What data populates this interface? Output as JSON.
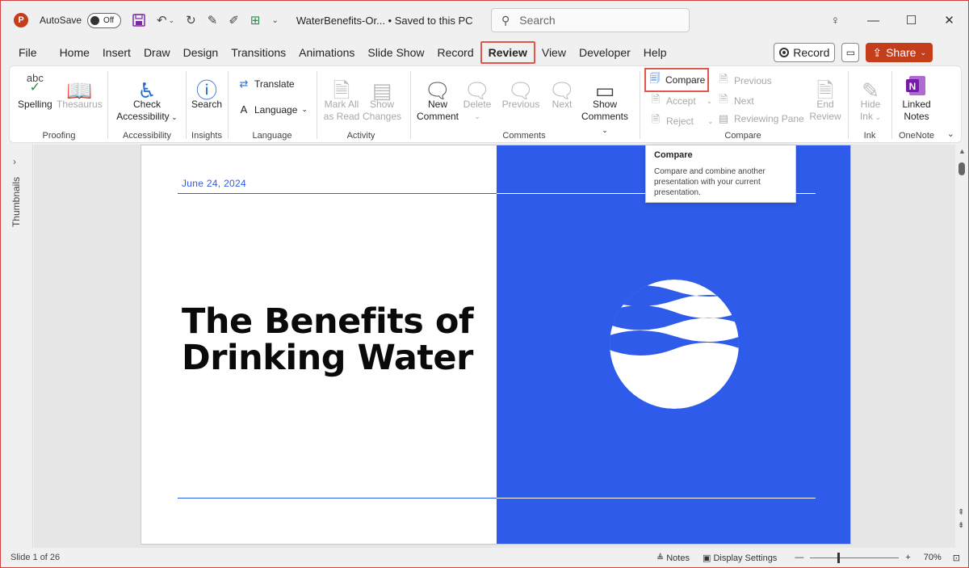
{
  "titlebar": {
    "app_logo": "P",
    "autosave_label": "AutoSave",
    "autosave_state": "Off",
    "doc_title": "WaterBenefits-Or...  •  Saved to this PC",
    "search_placeholder": "Search"
  },
  "menu": {
    "tabs": [
      "File",
      "Home",
      "Insert",
      "Draw",
      "Design",
      "Transitions",
      "Animations",
      "Slide Show",
      "Record",
      "Review",
      "View",
      "Developer",
      "Help"
    ],
    "active_tab": "Review",
    "record_label": "Record",
    "share_label": "Share"
  },
  "ribbon": {
    "proofing": {
      "spelling": "Spelling",
      "thesaurus": "Thesaurus",
      "label": "Proofing"
    },
    "accessibility": {
      "check_line1": "Check",
      "check_line2": "Accessibility",
      "label": "Accessibility"
    },
    "insights": {
      "search": "Search",
      "label": "Insights"
    },
    "language": {
      "translate": "Translate",
      "language": "Language",
      "label": "Language"
    },
    "activity": {
      "mark_line1": "Mark All",
      "mark_line2": "as Read",
      "show_line1": "Show",
      "show_line2": "Changes",
      "label": "Activity"
    },
    "comments": {
      "new_line1": "New",
      "new_line2": "Comment",
      "delete": "Delete",
      "previous": "Previous",
      "next": "Next",
      "show_line1": "Show",
      "show_line2": "Comments",
      "label": "Comments"
    },
    "compare": {
      "compare": "Compare",
      "accept": "Accept",
      "reject": "Reject",
      "previous": "Previous",
      "next": "Next",
      "reviewing_pane": "Reviewing Pane",
      "end_line1": "End",
      "end_line2": "Review",
      "label": "Compare"
    },
    "ink": {
      "hide_line1": "Hide",
      "hide_line2": "Ink",
      "label": "Ink"
    },
    "onenote": {
      "linked_line1": "Linked",
      "linked_line2": "Notes",
      "label": "OneNote"
    }
  },
  "tooltip": {
    "title": "Compare",
    "body": "Compare and combine another presentation with your current presentation."
  },
  "sidebar": {
    "label": "Thumbnails"
  },
  "slide": {
    "date": "June 24, 2024",
    "title_line1": "The Benefits of",
    "title_line2": "Drinking Water",
    "accent_color": "#2f5bea"
  },
  "status": {
    "slide_count": "Slide 1 of 26",
    "notes": "Notes",
    "display_settings": "Display Settings",
    "zoom": "70%"
  }
}
